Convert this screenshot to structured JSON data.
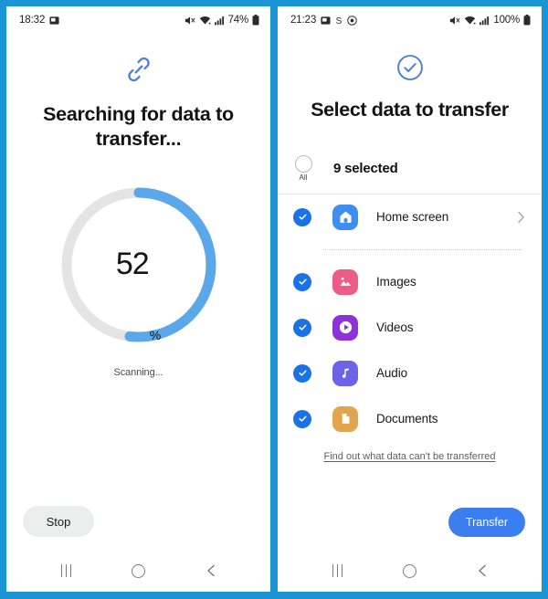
{
  "theme": {
    "frame_blue": "#1a95d4",
    "accent_blue": "#1b72e8",
    "progress_blue": "#5aa7ea",
    "track_gray": "#e4e4e4",
    "button_blue": "#3b7ef0"
  },
  "left_phone": {
    "status": {
      "time": "18:32",
      "icons_left": [
        "screenshot-icon"
      ],
      "icons_right": [
        "mute-icon",
        "wifi-icon",
        "signal-icon"
      ],
      "battery": "74%"
    },
    "header": {
      "icon": "link-icon",
      "title": "Searching for data to transfer..."
    },
    "progress": {
      "percent": 52,
      "percent_label": "52",
      "percent_symbol": "%",
      "status_text": "Scanning..."
    },
    "actions": {
      "stop_label": "Stop"
    },
    "navbar": [
      "recents-icon",
      "home-icon",
      "back-icon"
    ]
  },
  "right_phone": {
    "status": {
      "time": "21:23",
      "icons_left": [
        "screenshot-icon",
        "dollar-icon",
        "record-icon"
      ],
      "icons_right": [
        "mute-icon",
        "wifi-icon",
        "signal-icon"
      ],
      "battery": "100%"
    },
    "header": {
      "icon": "check-circle-icon",
      "title": "Select data to transfer"
    },
    "select_all": {
      "checked": false,
      "sub_label": "All",
      "count_label": "9 selected"
    },
    "items": [
      {
        "label": "Home screen",
        "icon": "home-screen-icon",
        "icon_color": "#3e8ef0",
        "checked": true,
        "has_chevron": true
      },
      {
        "label": "Images",
        "icon": "images-icon",
        "icon_color": "#ee5b87",
        "checked": true,
        "has_chevron": false
      },
      {
        "label": "Videos",
        "icon": "videos-icon",
        "icon_color": "#8c32d6",
        "checked": true,
        "has_chevron": false
      },
      {
        "label": "Audio",
        "icon": "audio-icon",
        "icon_color": "#6d63e8",
        "checked": true,
        "has_chevron": false
      },
      {
        "label": "Documents",
        "icon": "documents-icon",
        "icon_color": "#e3a44e",
        "checked": true,
        "has_chevron": false
      }
    ],
    "footer_link": "Find out what data can't be transferred",
    "actions": {
      "transfer_label": "Transfer"
    },
    "navbar": [
      "recents-icon",
      "home-icon",
      "back-icon"
    ]
  }
}
